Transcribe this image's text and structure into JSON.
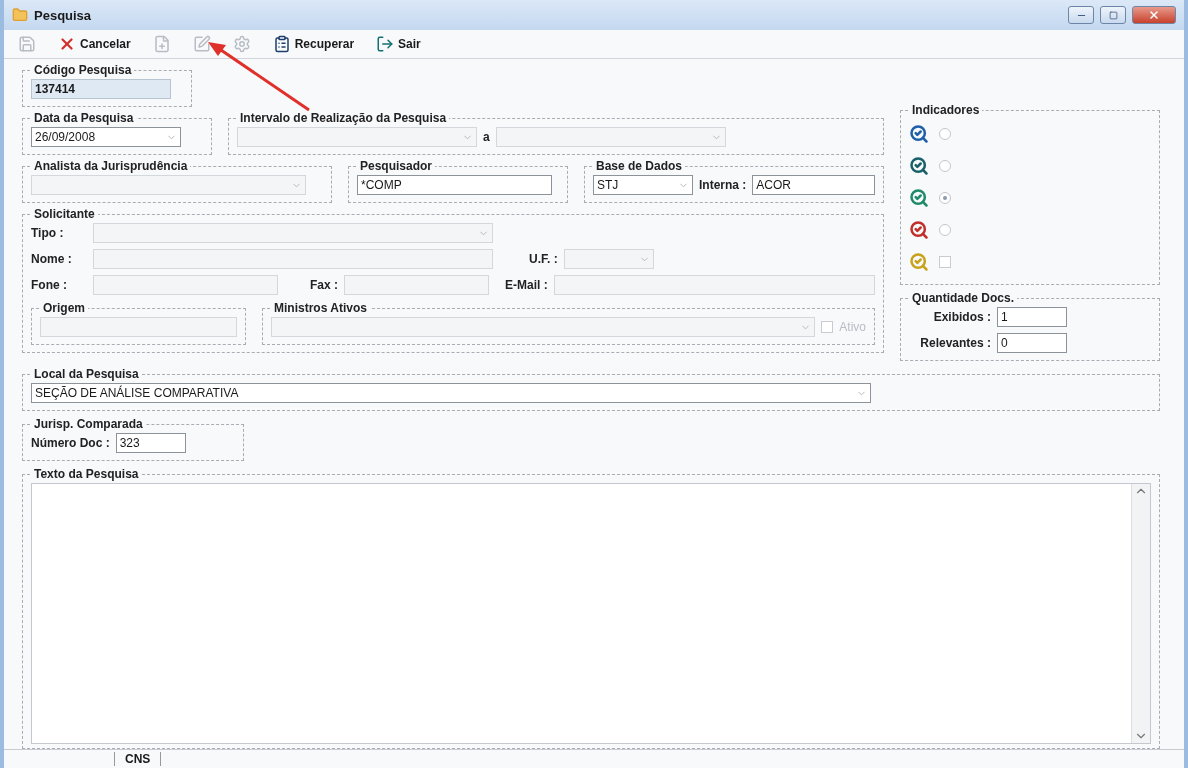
{
  "window": {
    "title": "Pesquisa"
  },
  "toolbar": [
    {
      "kind": "save",
      "disabled": true
    },
    {
      "kind": "cancel",
      "label": "Cancelar",
      "disabled": false
    },
    {
      "kind": "new",
      "disabled": true
    },
    {
      "kind": "edit",
      "disabled": true
    },
    {
      "kind": "delete",
      "disabled": true
    },
    {
      "kind": "retrieve",
      "label": "Recuperar",
      "disabled": false
    },
    {
      "kind": "exit",
      "label": "Sair",
      "disabled": false
    }
  ],
  "codigo": {
    "label": "Código Pesquisa",
    "value": "137414"
  },
  "data": {
    "label": "Data da Pesquisa",
    "value": "26/09/2008"
  },
  "intervalo": {
    "label": "Intervalo de Realização da Pesquisa",
    "separator": "a"
  },
  "analista": {
    "label": "Analista da Jurisprudência"
  },
  "pesquisador": {
    "label": "Pesquisador",
    "value": "*COMP"
  },
  "base": {
    "label": "Base de Dados",
    "value": "STJ",
    "interna_label": "Interna :",
    "interna_value": "ACOR"
  },
  "solicitante": {
    "label": "Solicitante",
    "tipo_label": "Tipo :",
    "nome_label": "Nome :",
    "uf_label": "U.F. :",
    "fone_label": "Fone :",
    "fax_label": "Fax :",
    "email_label": "E-Mail :"
  },
  "origem": {
    "label": "Origem"
  },
  "ministros": {
    "label": "Ministros Ativos",
    "ativo": {
      "label": "Ativo",
      "checked": false,
      "disabled": true
    }
  },
  "indicadores": {
    "label": "Indicadores",
    "items": [
      {
        "kind": "radio",
        "selected": false,
        "color": "#1f5fa8"
      },
      {
        "kind": "radio",
        "selected": false,
        "color": "#17606a"
      },
      {
        "kind": "radio",
        "selected": true,
        "color": "#1e8a6a"
      },
      {
        "kind": "radio",
        "selected": false,
        "color": "#c0302a"
      },
      {
        "kind": "checkbox",
        "selected": false,
        "color": "#c9a21c"
      }
    ]
  },
  "quantidade": {
    "label": "Quantidade Docs.",
    "exibidos_label": "Exibidos :",
    "exibidos": "1",
    "relevantes_label": "Relevantes :",
    "relevantes": "0"
  },
  "local": {
    "label": "Local da Pesquisa",
    "value": "SEÇÃO DE ANÁLISE COMPARATIVA"
  },
  "jurisp": {
    "label": "Jurisp. Comparada",
    "numero_label": "Número Doc :",
    "numero": "323"
  },
  "texto": {
    "label": "Texto da Pesquisa"
  },
  "status_bar": [
    "CNS"
  ]
}
